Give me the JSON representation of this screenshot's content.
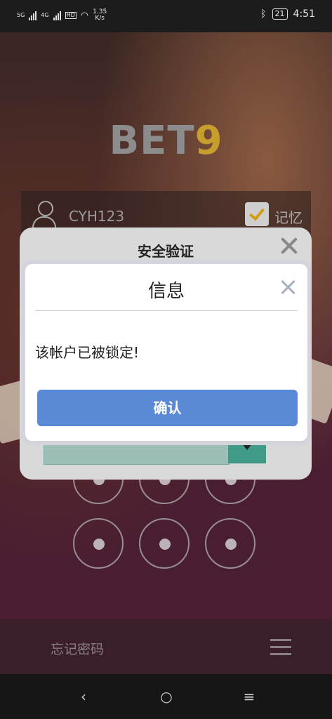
{
  "status_bar": {
    "network_1": "5G",
    "network_2": "4G",
    "hd_label": "HD",
    "speed_value": "1.35",
    "speed_unit": "K/s",
    "battery": "21",
    "time": "4:51"
  },
  "background": {
    "logo_text": "BET",
    "logo_digit": "9",
    "username": "CYH123",
    "remember_label": "记忆",
    "forgot_password": "忘记密码"
  },
  "security_dialog": {
    "title": "安全验证"
  },
  "info_dialog": {
    "title": "信息",
    "message": "该帐户已被锁定!",
    "confirm_label": "确认"
  },
  "colors": {
    "confirm_button": "#5a89d5",
    "logo_gray": "#8c8c8c",
    "logo_gold": "#c69e2d",
    "checkbox_tick": "#d39c12"
  }
}
